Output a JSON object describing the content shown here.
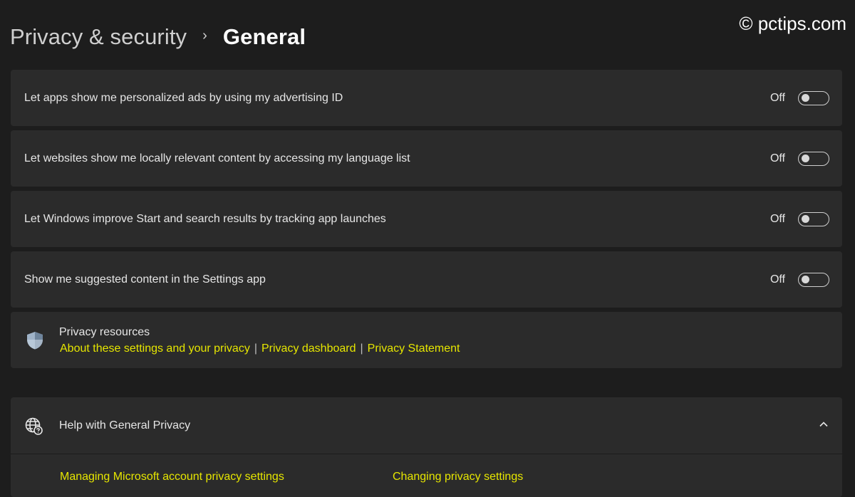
{
  "header": {
    "parent": "Privacy & security",
    "separator": "›",
    "current": "General"
  },
  "watermark": "© pctips.com",
  "settings": [
    {
      "label": "Let apps show me personalized ads by using my advertising ID",
      "state": "Off"
    },
    {
      "label": "Let websites show me locally relevant content by accessing my language list",
      "state": "Off"
    },
    {
      "label": "Let Windows improve Start and search results by tracking app launches",
      "state": "Off"
    },
    {
      "label": "Show me suggested content in the Settings app",
      "state": "Off"
    }
  ],
  "privacy_resources": {
    "title": "Privacy resources",
    "icon": "shield-icon",
    "links": [
      "About these settings and your privacy",
      "Privacy dashboard",
      "Privacy Statement"
    ],
    "separator": "|"
  },
  "help": {
    "title": "Help with General Privacy",
    "icon": "globe-help-icon",
    "expanded": true,
    "links": [
      "Managing Microsoft account privacy settings",
      "Changing privacy settings"
    ]
  },
  "colors": {
    "background": "#1d1d1d",
    "card": "#2b2b2b",
    "link": "#e6e600"
  }
}
